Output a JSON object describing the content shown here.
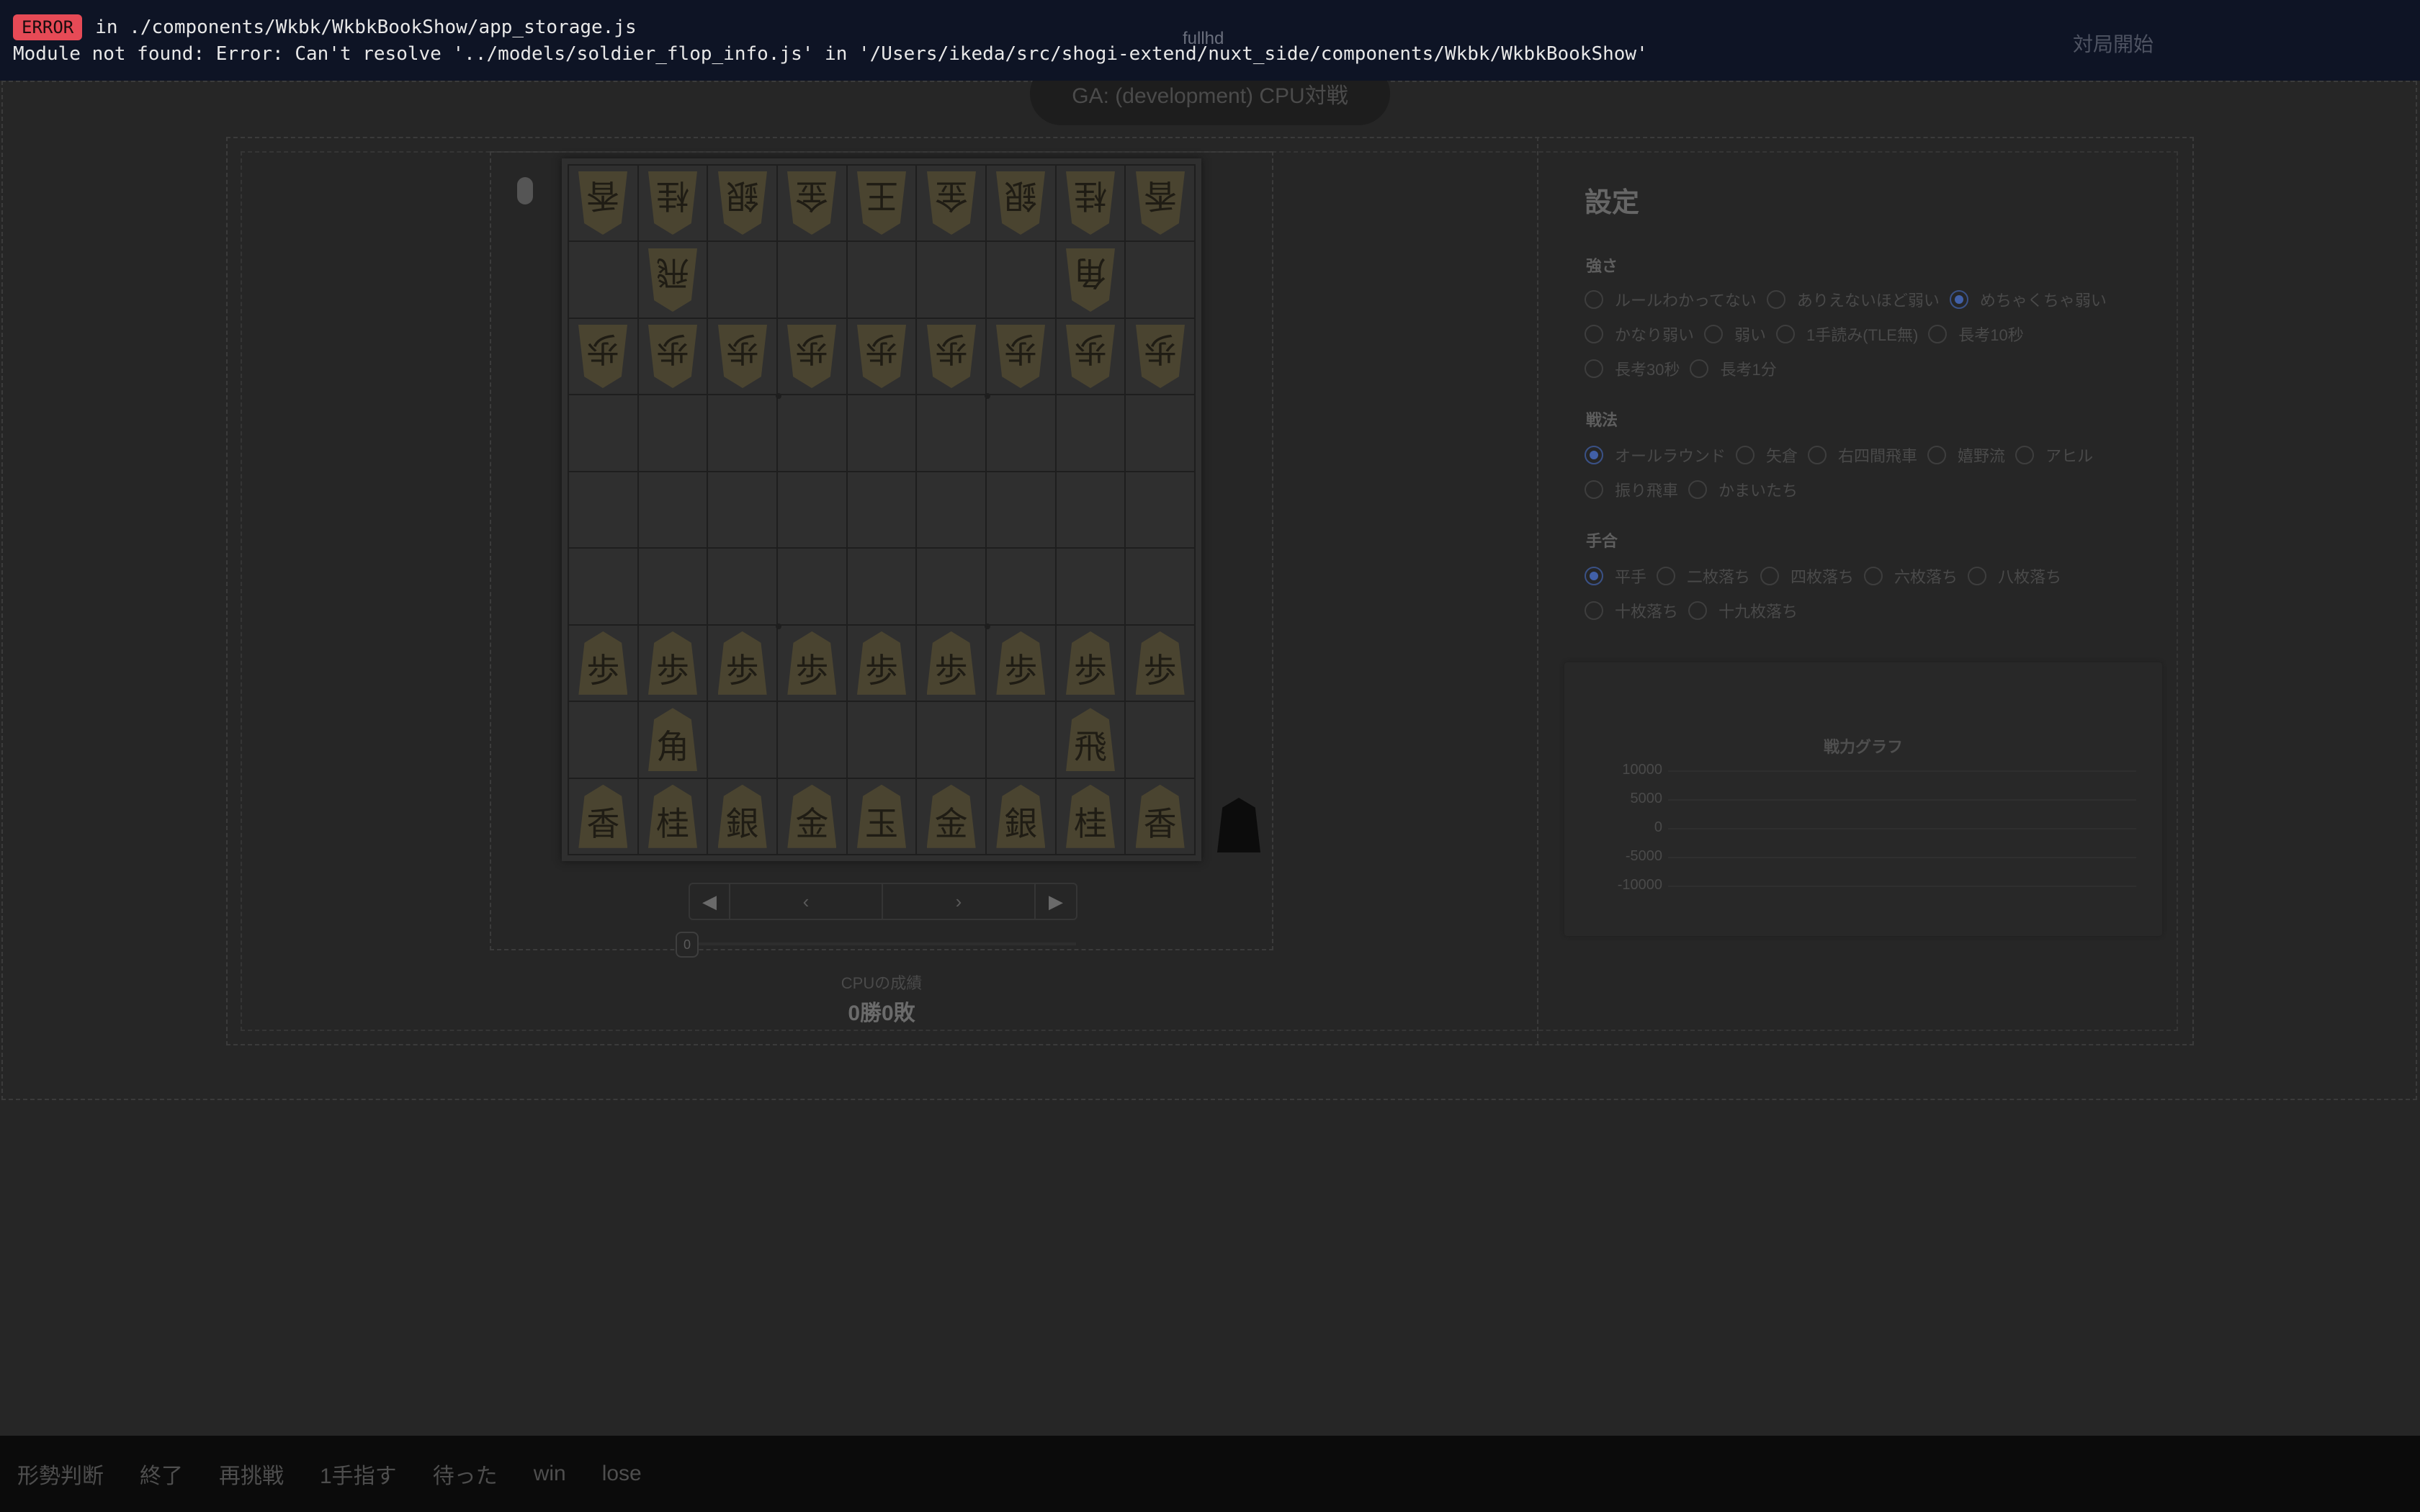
{
  "error": {
    "badge": "ERROR",
    "path": "in ./components/Wkbk/WkbkBookShow/app_storage.js",
    "message": "Module not found: Error: Can't resolve '../models/soldier_flop_info.js' in '/Users/ikeda/src/shogi-extend/nuxt_side/components/Wkbk/WkbkBookShow'"
  },
  "header": {
    "center_text": "fullhd",
    "right_text": "対局開始"
  },
  "title_pill": "GA: (development) CPU対戦",
  "board": {
    "rows": [
      [
        "香",
        "桂",
        "銀",
        "金",
        "王",
        "金",
        "銀",
        "桂",
        "香"
      ],
      [
        "",
        "飛",
        "",
        "",
        "",
        "",
        "",
        "角",
        ""
      ],
      [
        "歩",
        "歩",
        "歩",
        "歩",
        "歩",
        "歩",
        "歩",
        "歩",
        "歩"
      ],
      [
        "",
        "",
        "",
        "",
        "",
        "",
        "",
        "",
        ""
      ],
      [
        "",
        "",
        "",
        "",
        "",
        "",
        "",
        "",
        ""
      ],
      [
        "",
        "",
        "",
        "",
        "",
        "",
        "",
        "",
        ""
      ],
      [
        "歩",
        "歩",
        "歩",
        "歩",
        "歩",
        "歩",
        "歩",
        "歩",
        "歩"
      ],
      [
        "",
        "角",
        "",
        "",
        "",
        "",
        "",
        "飛",
        ""
      ],
      [
        "香",
        "桂",
        "銀",
        "金",
        "玉",
        "金",
        "銀",
        "桂",
        "香"
      ]
    ],
    "gote_rows": [
      0,
      1,
      2
    ]
  },
  "nav": {
    "first": "◀",
    "prev": "‹",
    "next": "›",
    "last": "▶"
  },
  "slider": {
    "value": "0"
  },
  "record": {
    "label": "CPUの成績",
    "value": "0勝0敗"
  },
  "settings": {
    "title": "設定",
    "strength": {
      "label": "強さ",
      "options": [
        "ルールわかってない",
        "ありえないほど弱い",
        "めちゃくちゃ弱い",
        "かなり弱い",
        "弱い",
        "1手読み(TLE無)",
        "長考10秒",
        "長考30秒",
        "長考1分"
      ],
      "selected": "めちゃくちゃ弱い"
    },
    "strategy": {
      "label": "戦法",
      "options": [
        "オールラウンド",
        "矢倉",
        "右四間飛車",
        "嬉野流",
        "アヒル",
        "振り飛車",
        "かまいたち"
      ],
      "selected": "オールラウンド"
    },
    "handicap": {
      "label": "手合",
      "options": [
        "平手",
        "二枚落ち",
        "四枚落ち",
        "六枚落ち",
        "八枚落ち",
        "十枚落ち",
        "十九枚落ち"
      ],
      "selected": "平手"
    }
  },
  "graph": {
    "title": "戦力グラフ",
    "y_ticks": [
      "10000",
      "5000",
      "0",
      "-5000",
      "-10000"
    ]
  },
  "bottom_bar": [
    "形勢判断",
    "終了",
    "再挑戦",
    "1手指す",
    "待った",
    "win",
    "lose"
  ],
  "colors": {
    "error_badge": "#e64a56",
    "radio_selected": "#4160a8",
    "background": "#262626"
  }
}
